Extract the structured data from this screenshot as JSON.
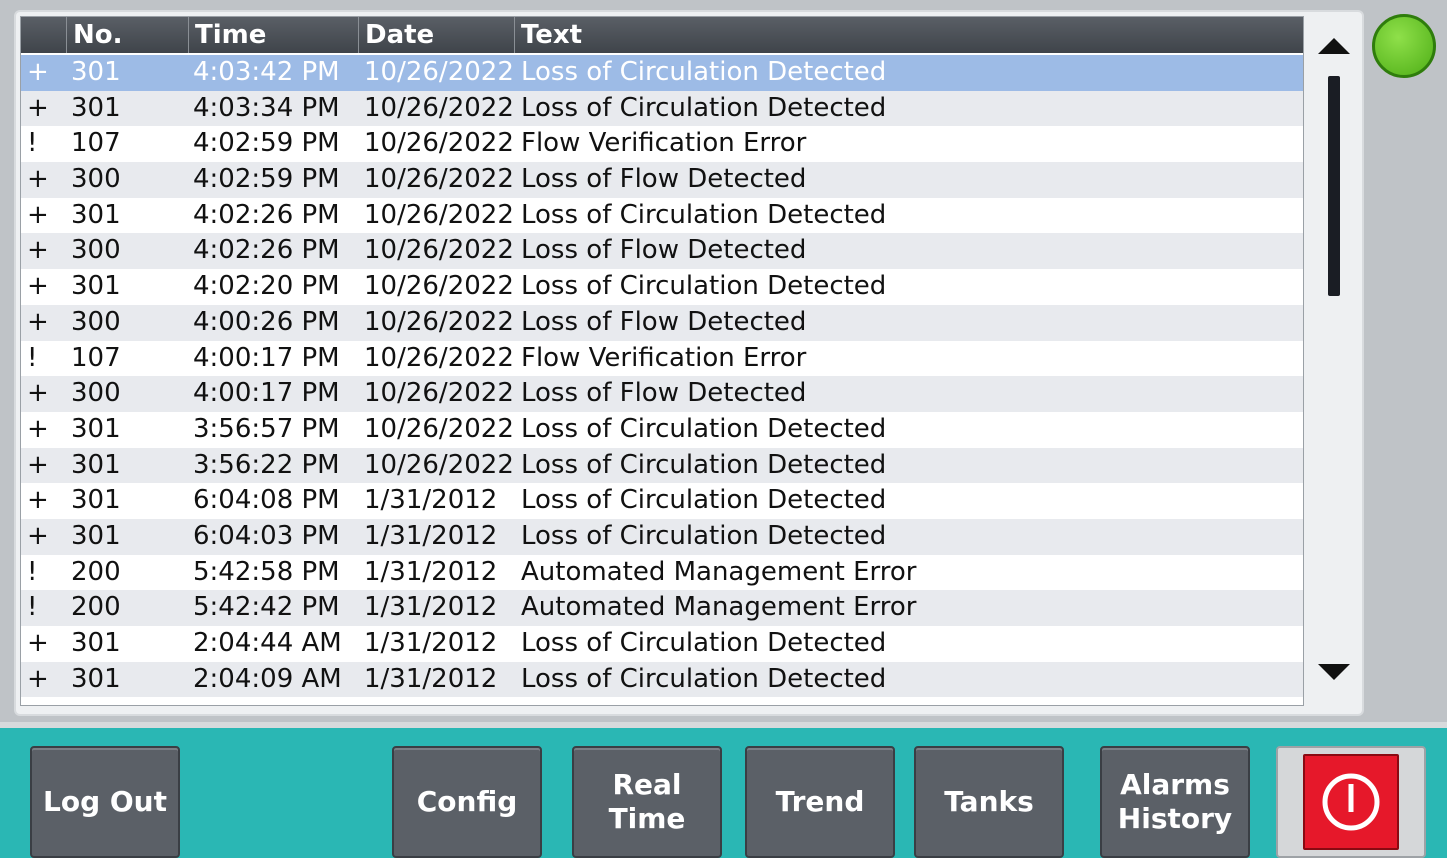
{
  "table": {
    "headers": {
      "no": "No.",
      "time": "Time",
      "date": "Date",
      "text": "Text"
    },
    "rows": [
      {
        "flag": "+",
        "no": "301",
        "time": "4:03:42 PM",
        "date": "10/26/2022",
        "text": "Loss of Circulation Detected",
        "selected": true
      },
      {
        "flag": "+",
        "no": "301",
        "time": "4:03:34 PM",
        "date": "10/26/2022",
        "text": "Loss of Circulation Detected"
      },
      {
        "flag": "!",
        "no": "107",
        "time": "4:02:59 PM",
        "date": "10/26/2022",
        "text": "Flow Verification Error"
      },
      {
        "flag": "+",
        "no": "300",
        "time": "4:02:59 PM",
        "date": "10/26/2022",
        "text": "Loss of Flow Detected"
      },
      {
        "flag": "+",
        "no": "301",
        "time": "4:02:26 PM",
        "date": "10/26/2022",
        "text": "Loss of Circulation Detected"
      },
      {
        "flag": "+",
        "no": "300",
        "time": "4:02:26 PM",
        "date": "10/26/2022",
        "text": "Loss of Flow Detected"
      },
      {
        "flag": "+",
        "no": "301",
        "time": "4:02:20 PM",
        "date": "10/26/2022",
        "text": "Loss of Circulation Detected"
      },
      {
        "flag": "+",
        "no": "300",
        "time": "4:00:26 PM",
        "date": "10/26/2022",
        "text": "Loss of Flow Detected"
      },
      {
        "flag": "!",
        "no": "107",
        "time": "4:00:17 PM",
        "date": "10/26/2022",
        "text": "Flow Verification Error"
      },
      {
        "flag": "+",
        "no": "300",
        "time": "4:00:17 PM",
        "date": "10/26/2022",
        "text": "Loss of Flow Detected"
      },
      {
        "flag": "+",
        "no": "301",
        "time": "3:56:57 PM",
        "date": "10/26/2022",
        "text": "Loss of Circulation Detected"
      },
      {
        "flag": "+",
        "no": "301",
        "time": "3:56:22 PM",
        "date": "10/26/2022",
        "text": "Loss of Circulation Detected"
      },
      {
        "flag": "+",
        "no": "301",
        "time": "6:04:08 PM",
        "date": "1/31/2012",
        "text": "Loss of Circulation Detected"
      },
      {
        "flag": "+",
        "no": "301",
        "time": "6:04:03 PM",
        "date": "1/31/2012",
        "text": "Loss of Circulation Detected"
      },
      {
        "flag": "!",
        "no": "200",
        "time": "5:42:58 PM",
        "date": "1/31/2012",
        "text": "Automated Management Error"
      },
      {
        "flag": "!",
        "no": "200",
        "time": "5:42:42 PM",
        "date": "1/31/2012",
        "text": "Automated Management Error"
      },
      {
        "flag": "+",
        "no": "301",
        "time": "2:04:44 AM",
        "date": "1/31/2012",
        "text": "Loss of Circulation Detected"
      },
      {
        "flag": "+",
        "no": "301",
        "time": "2:04:09 AM",
        "date": "1/31/2012",
        "text": "Loss of Circulation Detected"
      }
    ]
  },
  "status_indicator": {
    "color": "#5cc21e"
  },
  "nav": {
    "logout": [
      "Log Out"
    ],
    "config": [
      "Config"
    ],
    "realtime": [
      "Real",
      "Time"
    ],
    "trend": [
      "Trend"
    ],
    "tanks": [
      "Tanks"
    ],
    "alarms": [
      "Alarms",
      "History"
    ]
  },
  "colors": {
    "bottom_bar": "#2ab7b4",
    "button": "#5b6067",
    "power": "#e6182a",
    "selected_row": "#9dbbe6"
  }
}
